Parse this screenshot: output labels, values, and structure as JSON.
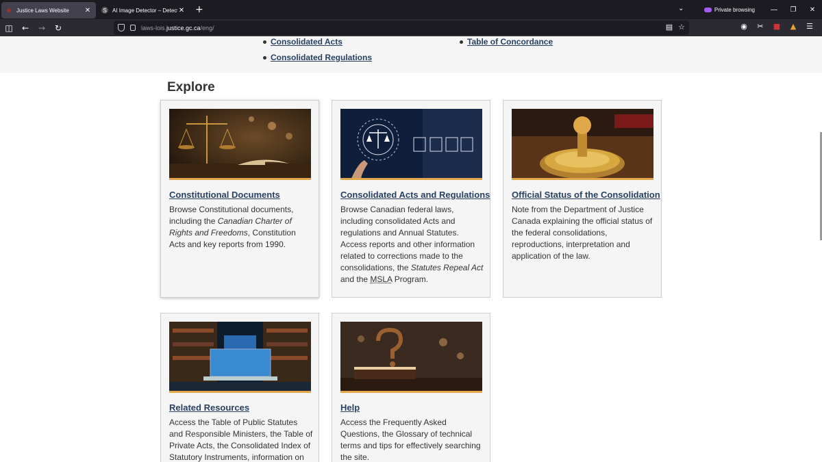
{
  "browser": {
    "tabs": [
      {
        "title": "Justice Laws Website",
        "active": true
      },
      {
        "title": "AI Image Detector – Detect AI-G",
        "active": false
      }
    ],
    "private_label": "Private browsing",
    "url_prefix": "laws-lois.",
    "url_host": "justice.gc.ca",
    "url_path": "/eng/"
  },
  "top_links": {
    "consolidated_acts": "Consolidated Acts",
    "consolidated_regulations": "Consolidated Regulations",
    "table_of_concordance": "Table of Concordance"
  },
  "explore": {
    "heading": "Explore",
    "cards": [
      {
        "title": "Constitutional Documents",
        "desc_pre": "Browse Constitutional documents, including the ",
        "desc_em": "Canadian Charter of Rights and Freedoms",
        "desc_post": ", Constitution Acts and key reports from 1990."
      },
      {
        "title": "Consolidated Acts and Regulations",
        "desc_pre": "Browse Canadian federal laws, including consolidated Acts and regulations and Annual Statutes. Access reports and other information related to corrections made to the consolidations, the ",
        "desc_em": "Statutes Repeal Act",
        "desc_mid": " and the ",
        "desc_abbr": "MSLA",
        "desc_post": " Program."
      },
      {
        "title": "Official Status of the Consolidation",
        "desc": "Note from the Department of Justice Canada explaining the official status of the federal consolidations, reproductions, interpretation and application of the law."
      },
      {
        "title": "Related Resources",
        "desc": "Access the Table of Public Statutes and Responsible Ministers, the Table of Private Acts, the Consolidated Index of Statutory Instruments, information on"
      },
      {
        "title": "Help",
        "desc": "Access the Frequently Asked Questions, the Glossary of technical terms and tips for effectively searching the site."
      }
    ]
  },
  "colors": {
    "link": "#284162",
    "accent_bar": "#e5a54a",
    "card_bg": "#f5f5f5"
  }
}
